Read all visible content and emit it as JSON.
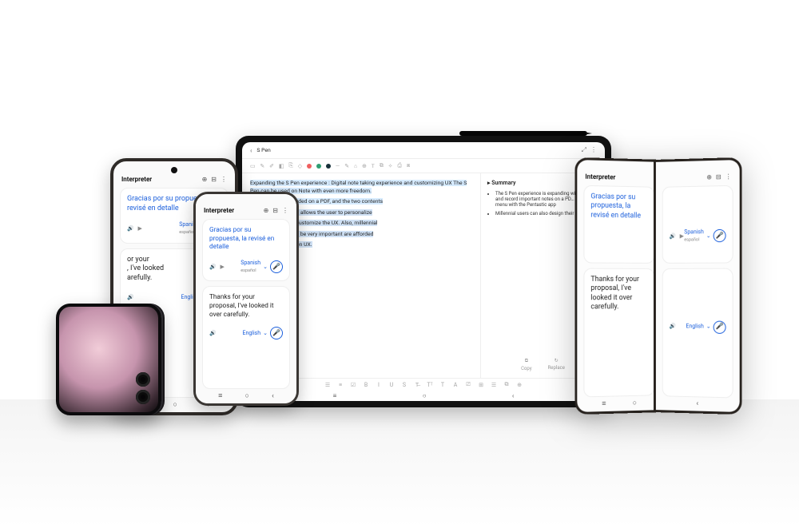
{
  "interpreter": {
    "app_title": "Interpreter",
    "icons": {
      "chat": "⊕",
      "columns": "⊟",
      "more": "⋮"
    },
    "source": {
      "text": "Gracias por su propuesta, la revisé en detalle",
      "speak_icon": "🔊",
      "play_icon": "▶",
      "lang_label": "Spanish",
      "lang_sub": "español"
    },
    "target": {
      "text_short": "Thanks for your proposal, I've looked it over carefully.",
      "text_clipped": "or your\n, I've looked\narefully.",
      "text_wide": "Thanks for your proposal, I've looked it over carefully.",
      "speak_icon": "🔊",
      "lang_label": "English"
    },
    "mic_icon": "🎤",
    "chevron": "⌄"
  },
  "tablet": {
    "back_label": "S Pen",
    "expand_icon": "⤢",
    "more_icon": "⋮",
    "toolbar_colors": [
      "#ef5f5f",
      "#2f9e72",
      "#17303a",
      "#555555"
    ],
    "note": {
      "p1": "Expanding the S Pen experience : Digital note taking experience and customizing UX The S Pen can be used on Note with even more freedom.",
      "p1_tail": "be written and recorded on a PDF, and the two contents",
      "p2": "app called Pentastic allows the user to personalize",
      "p3": "that they want and customize the UX. Also, millennial",
      "p4": "rsonal expression to be very important are afforded",
      "p5": "gning their own S Pen UX."
    },
    "summary": {
      "title": "Summary",
      "bullets": [
        "The S Pen experience is expanding with ri…  write and record important notes on a PD… S Pen menu with the Pentastic app",
        "Millennial users can also design their own…"
      ],
      "copy": "Copy",
      "replace": "Replace",
      "copy_icon": "⧉",
      "replace_icon": "↻"
    },
    "bottombar": [
      "☰",
      "≡",
      "☑",
      "B",
      "I",
      "U",
      "S",
      "T̶",
      "Tᵀ",
      "T",
      "A",
      "⎚",
      "⊞",
      "☰",
      "⧉",
      "⊕"
    ],
    "nav": {
      "recent": "≡",
      "home": "○",
      "back": "‹"
    }
  },
  "flip": {
    "cam_count": 2
  },
  "nav3": {
    "recent": "≡",
    "home": "○",
    "back": "‹"
  }
}
